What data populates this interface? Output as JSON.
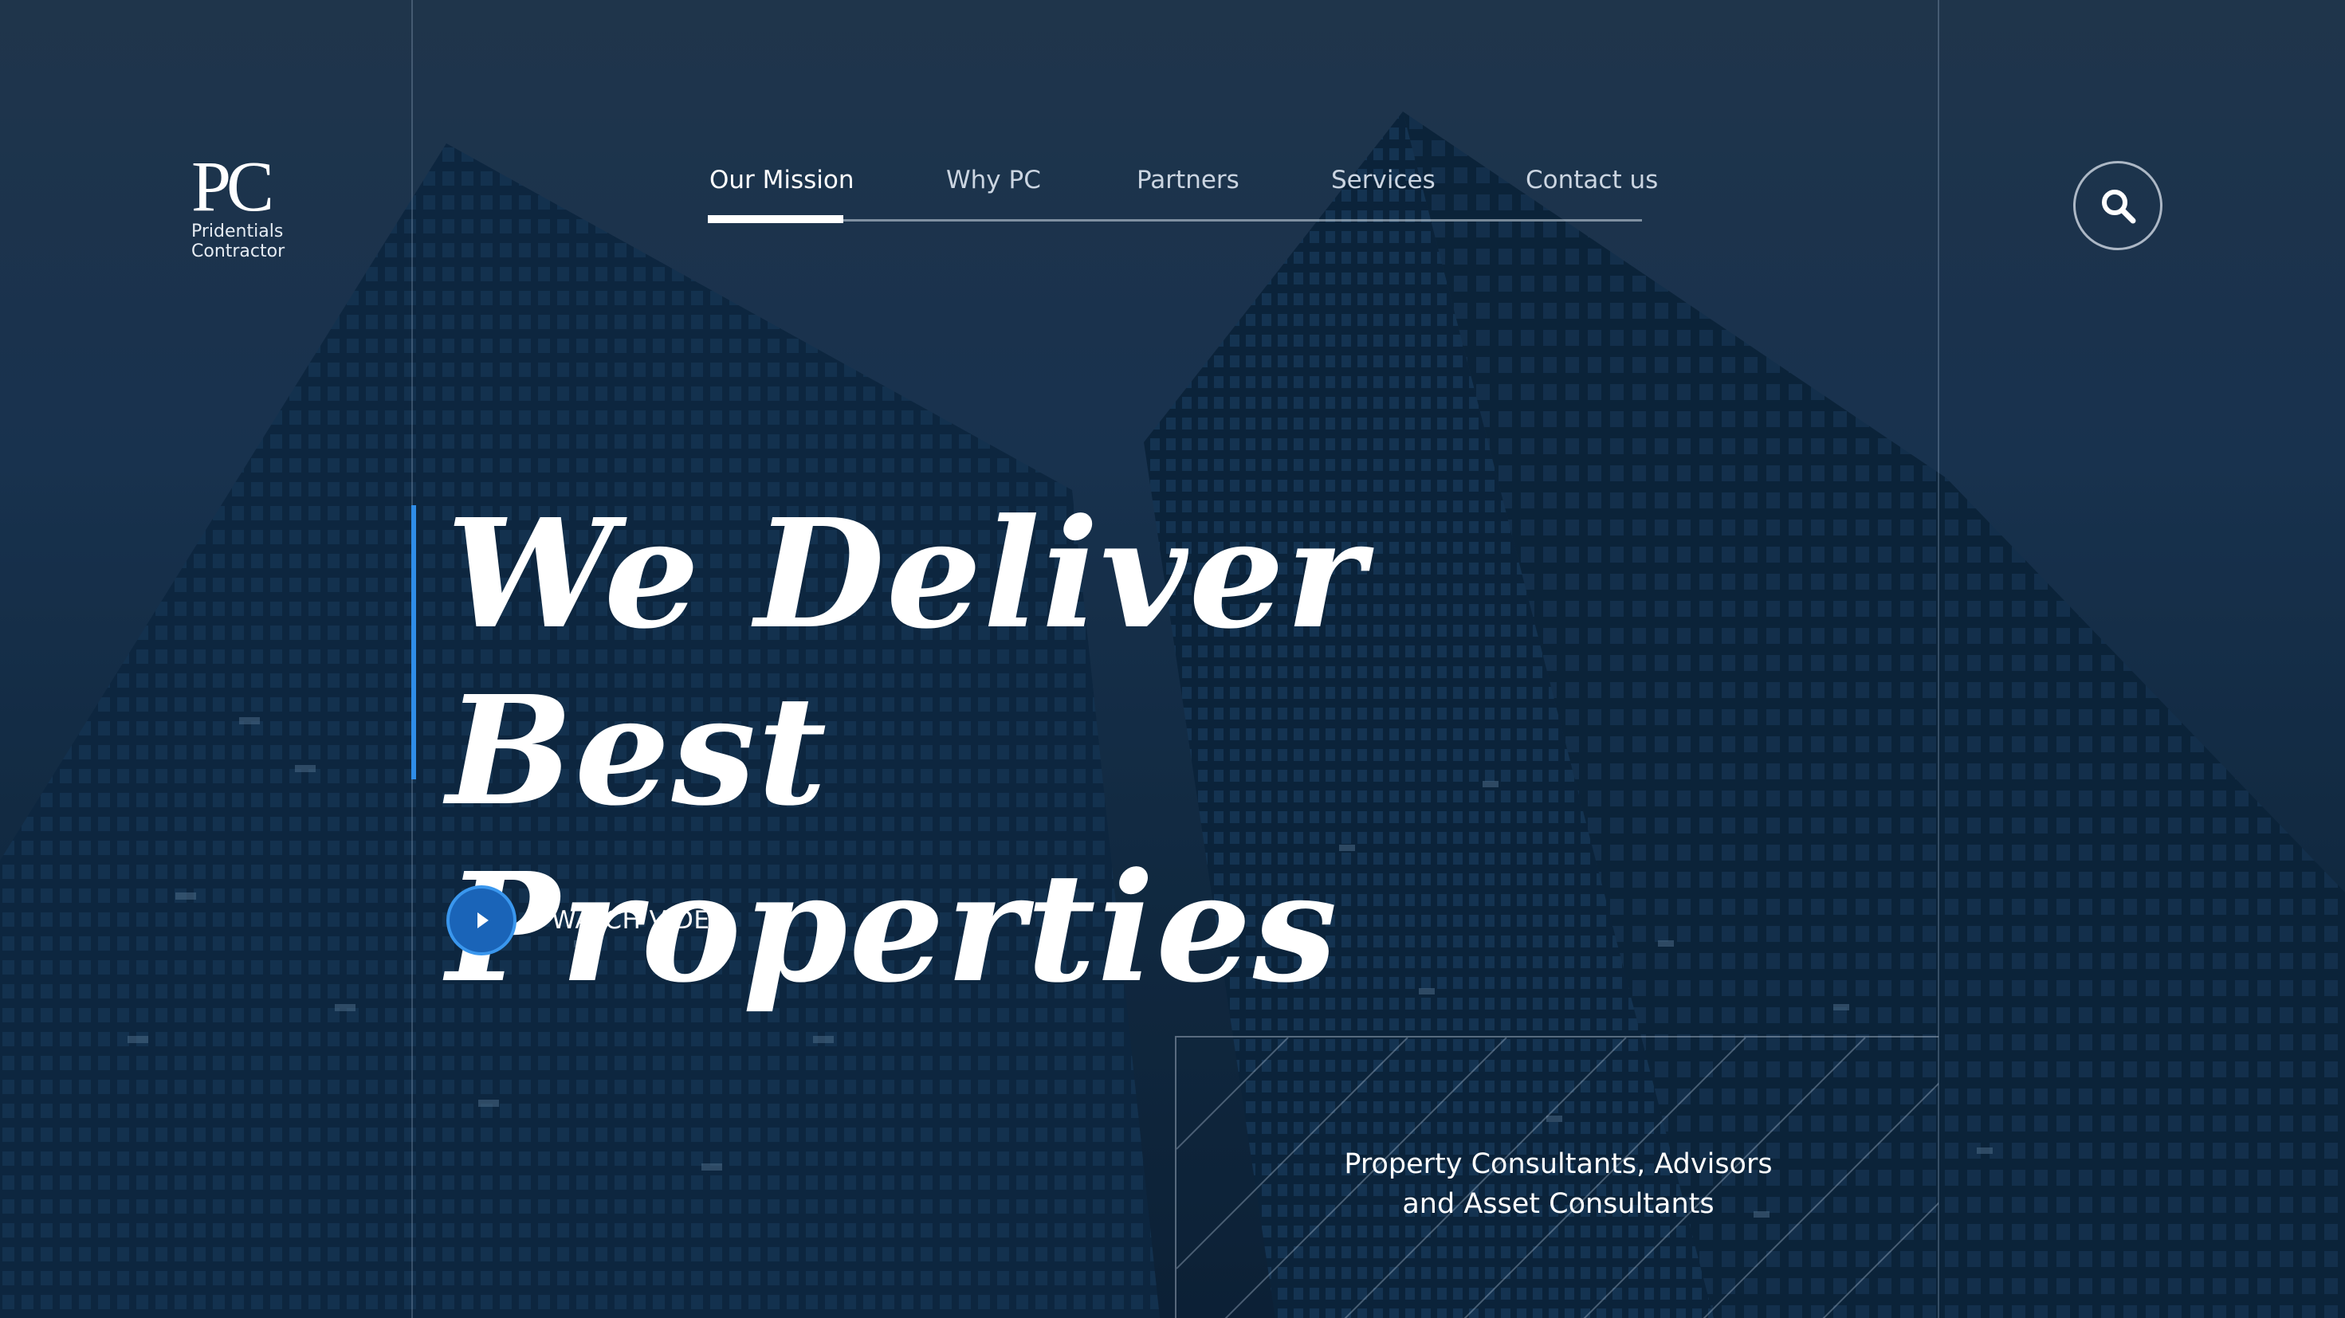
{
  "brand": {
    "logo_mark": "PC",
    "name_line1": "Pridentials",
    "name_line2": "Contractor"
  },
  "nav": {
    "items": [
      {
        "label": "Our Mission",
        "active": true
      },
      {
        "label": "Why PC",
        "active": false
      },
      {
        "label": "Partners",
        "active": false
      },
      {
        "label": "Services",
        "active": false
      },
      {
        "label": "Contact us",
        "active": false
      }
    ]
  },
  "search": {
    "icon": "search-icon"
  },
  "hero": {
    "title_line1": "We Deliver Best",
    "title_line2": "Properties",
    "watch_label": "WATCH VIDEO",
    "play_icon": "play-icon"
  },
  "info": {
    "line1": "Property Consultants, Advisors",
    "line2": "and Asset Consultants"
  },
  "colors": {
    "accent": "#2f8de8",
    "play_button": "#1a64b8",
    "background": "#12293f",
    "text": "#ffffff",
    "nav_inactive": "#cbd5e1"
  }
}
